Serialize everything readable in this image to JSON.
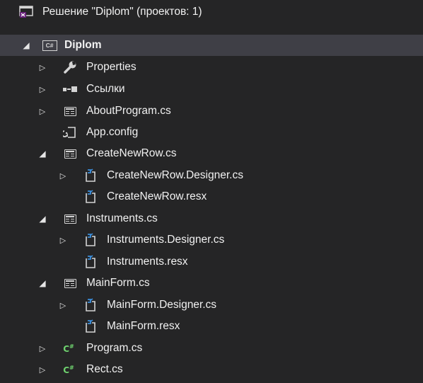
{
  "solution": {
    "title": "Решение \"Diplom\"  (проектов: 1)"
  },
  "project": {
    "name": "Diplom"
  },
  "items": {
    "properties": "Properties",
    "references": "Ссылки",
    "about_program": "AboutProgram.cs",
    "app_config": "App.config",
    "create_new_row": "CreateNewRow.cs",
    "create_new_row_designer": "CreateNewRow.Designer.cs",
    "create_new_row_resx": "CreateNewRow.resx",
    "instruments": "Instruments.cs",
    "instruments_designer": "Instruments.Designer.cs",
    "instruments_resx": "Instruments.resx",
    "main_form": "MainForm.cs",
    "main_form_designer": "MainForm.Designer.cs",
    "main_form_resx": "MainForm.resx",
    "program": "Program.cs",
    "rect": "Rect.cs"
  },
  "icons": {
    "solution": "vs-solution-icon",
    "project": "csharp-project-icon",
    "properties": "wrench-icon",
    "references": "references-icon",
    "form": "windows-form-icon",
    "config": "config-file-icon",
    "designer": "designer-file-icon",
    "cs": "csharp-file-icon"
  },
  "colors": {
    "background": "#252526",
    "selected_row": "#3f3f46",
    "text": "#f1f1f1",
    "csharp_green": "#6fd36f",
    "solution_purple": "#68217a",
    "designer_blue": "#3c8fdc"
  }
}
